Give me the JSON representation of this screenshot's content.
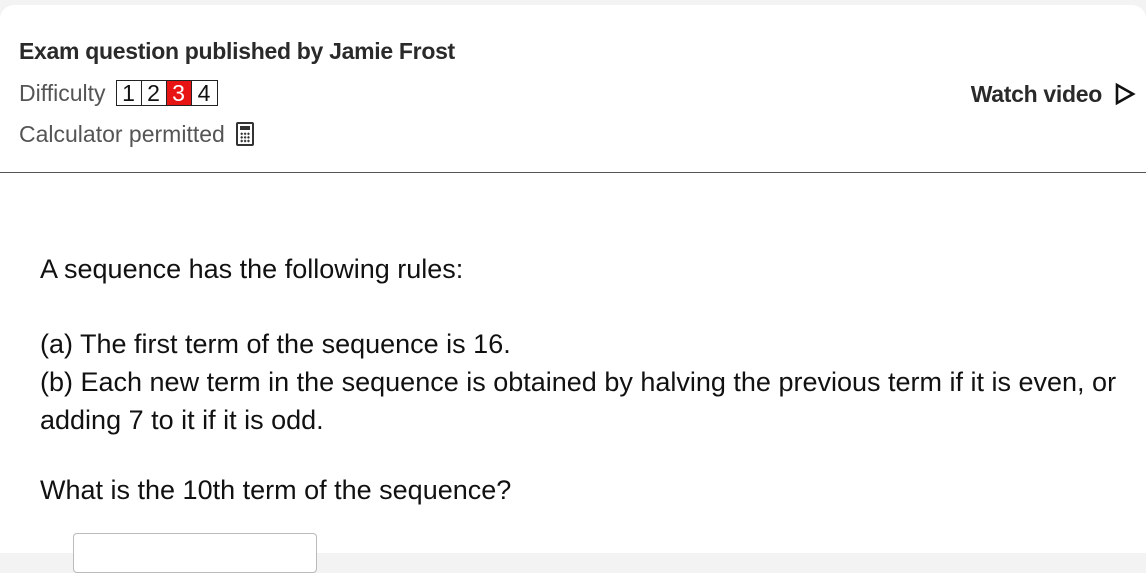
{
  "header": {
    "publisher": "Exam question published by Jamie Frost",
    "difficulty_label": "Difficulty",
    "difficulty_levels": [
      "1",
      "2",
      "3",
      "4"
    ],
    "difficulty_selected": "3",
    "calculator_label": "Calculator permitted",
    "calculator_icon": "calculator-icon",
    "watch_video_label": "Watch video",
    "watch_video_icon": "play-icon"
  },
  "question": {
    "intro": "A sequence has the following rules:",
    "rule_a": "(a) The first term of the sequence is 16.",
    "rule_b": "(b) Each new term in the sequence is obtained by halving the previous term if it is even, or adding 7 to it if it is odd.",
    "ask": "What is the 10th term of the sequence?"
  },
  "answer": {
    "value": ""
  },
  "colors": {
    "difficulty_active": "#e81313",
    "text": "#111111",
    "muted": "#555555"
  }
}
